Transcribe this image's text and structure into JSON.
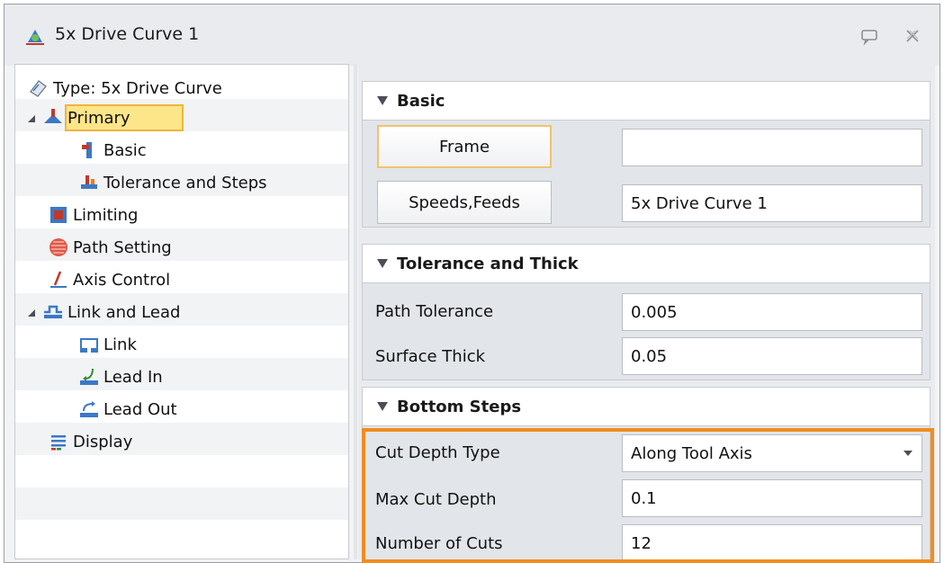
{
  "window": {
    "title": "5x Drive Curve 1",
    "icon": "drive-curve-app-icon",
    "pin_icon": "pin-icon",
    "close_icon": "close-icon"
  },
  "tree": {
    "type_label": "Type: 5x Drive Curve",
    "items": [
      {
        "label": "Primary",
        "icon": "primary-icon",
        "selected": true,
        "expanded": true
      },
      {
        "label": "Basic",
        "icon": "basic-icon"
      },
      {
        "label": "Tolerance and Steps",
        "icon": "tolerance-steps-icon"
      },
      {
        "label": "Limiting",
        "icon": "limiting-icon"
      },
      {
        "label": "Path Setting",
        "icon": "path-setting-icon"
      },
      {
        "label": "Axis Control",
        "icon": "axis-control-icon"
      },
      {
        "label": "Link and Lead",
        "icon": "link-lead-icon",
        "expanded": true
      },
      {
        "label": "Link",
        "icon": "link-icon"
      },
      {
        "label": "Lead In",
        "icon": "lead-in-icon"
      },
      {
        "label": "Lead Out",
        "icon": "lead-out-icon"
      },
      {
        "label": "Display",
        "icon": "display-icon"
      }
    ]
  },
  "basic": {
    "header": "Basic",
    "frame_button": "Frame",
    "frame_value": "",
    "speeds_button": "Speeds,Feeds",
    "speeds_value": "5x Drive Curve 1"
  },
  "tolerance": {
    "header": "Tolerance and Thick",
    "path_tolerance_label": "Path Tolerance",
    "path_tolerance_value": "0.005",
    "surface_thick_label": "Surface Thick",
    "surface_thick_value": "0.05"
  },
  "bottom_steps": {
    "header": "Bottom Steps",
    "cut_depth_type_label": "Cut Depth Type",
    "cut_depth_type_value": "Along Tool Axis",
    "max_cut_depth_label": "Max Cut Depth",
    "max_cut_depth_value": "0.1",
    "number_of_cuts_label": "Number of Cuts",
    "number_of_cuts_value": "12"
  },
  "colors": {
    "highlight": "#f28c1e",
    "selection_fill": "#fde58a",
    "selection_border": "#f0b43c"
  }
}
